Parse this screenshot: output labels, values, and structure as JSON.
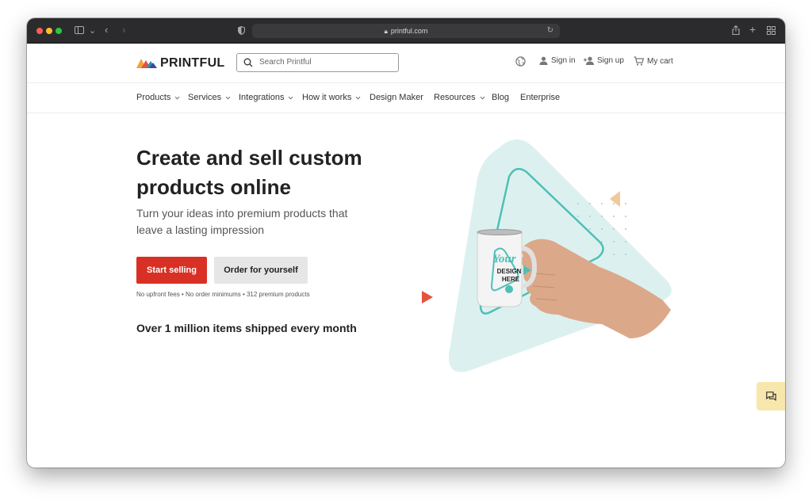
{
  "browser": {
    "url": "printful.com"
  },
  "header": {
    "logo_text": "PRINTFUL",
    "search_placeholder": "Search Printful",
    "sign_in": "Sign in",
    "sign_up": "Sign up",
    "cart": "My cart"
  },
  "nav": {
    "items": [
      {
        "label": "Products"
      },
      {
        "label": "Services"
      },
      {
        "label": "Integrations"
      },
      {
        "label": "How it works"
      },
      {
        "label": "Design Maker"
      },
      {
        "label": "Resources"
      },
      {
        "label": "Blog"
      },
      {
        "label": "Enterprise"
      }
    ]
  },
  "hero": {
    "title": "Create and sell custom products online",
    "subtitle": "Turn your ideas into premium products that leave a lasting impression",
    "primary_cta": "Start selling",
    "secondary_cta": "Order for yourself",
    "fine_print": "No upfront fees • No order minimums • 312 premium products",
    "shipped": "Over 1 million items shipped every month",
    "mug_text_1": "Your",
    "mug_text_2": "DESIGN",
    "mug_text_3": "HERE"
  },
  "colors": {
    "brand_red": "#d93025",
    "teal": "#4fbfb6",
    "teal_light": "#dcf1ef",
    "chat_yellow": "#f8e7ad"
  }
}
